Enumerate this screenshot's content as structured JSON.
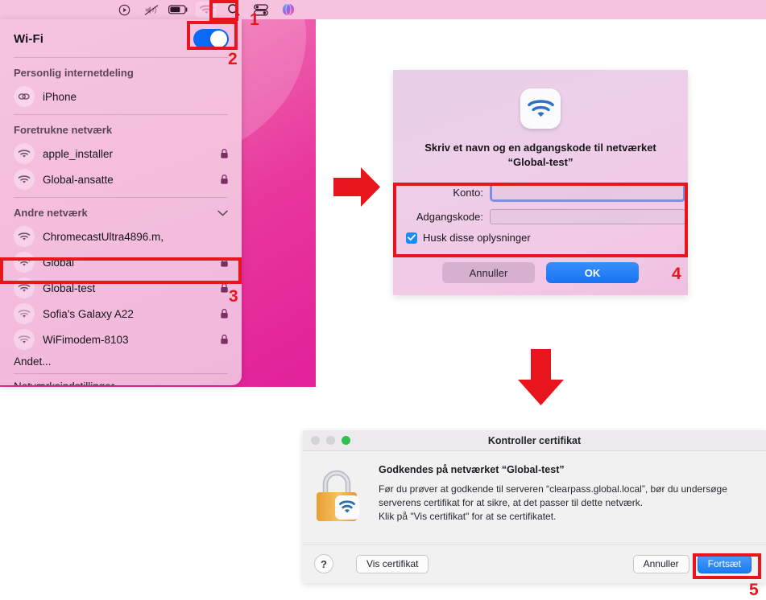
{
  "menubar": {
    "icons": [
      {
        "name": "now-playing-icon",
        "glyph": "play-circle"
      },
      {
        "name": "volume-muted-icon",
        "glyph": "speaker-mute"
      },
      {
        "name": "battery-icon",
        "glyph": "battery"
      },
      {
        "name": "wifi-icon",
        "glyph": "wifi"
      },
      {
        "name": "spotlight-search-icon",
        "glyph": "magnifier"
      },
      {
        "name": "control-center-icon",
        "glyph": "sliders"
      },
      {
        "name": "siri-icon",
        "glyph": "siri-orb"
      }
    ]
  },
  "wifi_menu": {
    "title": "Wi-Fi",
    "toggle_on": true,
    "hotspot_group_label": "Personlig internetdeling",
    "hotspot_items": [
      {
        "name": "iPhone",
        "icon": "hotspot-link-icon",
        "locked": false
      }
    ],
    "preferred_group_label": "Foretrukne netværk",
    "preferred_networks": [
      {
        "name": "apple_installer",
        "locked": true,
        "strength": 3
      },
      {
        "name": "Global-ansatte",
        "locked": true,
        "strength": 3
      }
    ],
    "other_group_label": "Andre netværk",
    "other_networks": [
      {
        "name": "ChromecastUltra4896.m,",
        "locked": false,
        "strength": 3
      },
      {
        "name": "Global",
        "locked": true,
        "strength": 3
      },
      {
        "name": "Global-test",
        "locked": true,
        "strength": 3
      },
      {
        "name": "Sofia's Galaxy A22",
        "locked": true,
        "strength": 1
      },
      {
        "name": "WiFimodem-8103",
        "locked": true,
        "strength": 1
      }
    ],
    "other_label": "Andet...",
    "network_settings_label": "Netværksindstillinger..."
  },
  "password_dialog": {
    "icon": "wifi-app-icon",
    "title_line1": "Skriv et navn og en adgangskode til netværket",
    "title_line2": "“Global-test”",
    "fields": [
      {
        "label": "Konto:",
        "value": "",
        "focused": true
      },
      {
        "label": "Adgangskode:",
        "value": "",
        "focused": false
      }
    ],
    "checkbox_label": "Husk disse oplysninger",
    "checkbox_checked": true,
    "cancel_label": "Annuller",
    "ok_label": "OK"
  },
  "certificate_window": {
    "title": "Kontroller certifikat",
    "traffic_lights": [
      "#d3d2d4",
      "#d3d2d4",
      "#2ec24c"
    ],
    "icon": "lock-wifi-icon",
    "heading": "Godkendes på netværket “Global-test”",
    "body_line1": "Før du prøver at godkende til serveren “clearpass.global.local”, bør du undersøge",
    "body_line2": "serverens certifikat for at sikre, at det passer til dette netværk.",
    "body_line3": "Klik på \"Vis certifikat\" for at se certifikatet.",
    "help_label": "?",
    "show_cert_label": "Vis certifikat",
    "cancel_label": "Annuller",
    "continue_label": "Fortsæt"
  },
  "annotations": {
    "accent_color": "#e8161c",
    "steps": [
      {
        "number": "1",
        "target": "menubar-wifi-icon"
      },
      {
        "number": "2",
        "target": "wifi-toggle"
      },
      {
        "number": "3",
        "target": "global-test-row"
      },
      {
        "number": "4",
        "target": "credentials-fields"
      },
      {
        "number": "5",
        "target": "continue-button"
      }
    ],
    "arrows": [
      {
        "name": "arrow-right",
        "direction": "right"
      },
      {
        "name": "arrow-down",
        "direction": "down"
      }
    ]
  }
}
